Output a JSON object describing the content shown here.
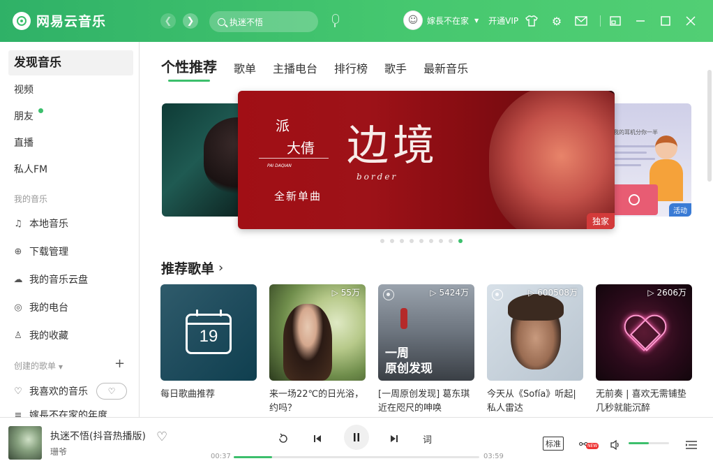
{
  "app": {
    "title": "网易云音乐"
  },
  "header": {
    "search_text": "执迷不悟",
    "username": "嫁長不在家",
    "vip_label": "开通VIP"
  },
  "sidebar": {
    "main_item": "发现音乐",
    "items": [
      "视频",
      "朋友",
      "直播",
      "私人FM"
    ],
    "my_music_label": "我的音乐",
    "my_music": [
      "本地音乐",
      "下载管理",
      "我的音乐云盘",
      "我的电台",
      "我的收藏"
    ],
    "created_label": "创建的歌单",
    "favorite_playlist": "我喜欢的音乐",
    "partial_item": "嫁長不在家的年度"
  },
  "tabs": [
    "个性推荐",
    "歌单",
    "主播电台",
    "排行榜",
    "歌手",
    "最新音乐"
  ],
  "banner": {
    "artist": "派 大倩",
    "artist_line1": "派",
    "artist_line2": "大倩",
    "artist_en": "PAI DAQIAN",
    "subtitle": "全新单曲",
    "title": "边境",
    "title_en": "border",
    "badge": "独家",
    "right_badge": "活动",
    "right_heading": "我的耳机分你一半",
    "dots_total": 9,
    "dot_active": 9
  },
  "recommend": {
    "title": "推荐歌单",
    "cards": [
      {
        "caption": "每日歌曲推荐",
        "plays": "",
        "day": "19"
      },
      {
        "caption": "来一场22℃的日光浴，约吗？",
        "plays": "55万"
      },
      {
        "caption": "[一周原创发现] 葛东琪近在咫尺的呻唤",
        "plays": "5424万",
        "overlay": "一周\n原创发现"
      },
      {
        "caption": "今天从《Sofía》听起|私人雷达",
        "plays": "600508万"
      },
      {
        "caption": "无前奏 | 喜欢无需铺垫几秒就能沉醉",
        "plays": "2606万"
      }
    ]
  },
  "player": {
    "song": "执迷不悟(抖音热播版)",
    "artist": "珊爷",
    "current_time": "00:37",
    "total_time": "03:59",
    "progress": 0.155,
    "lyrics_label": "词",
    "quality": "标准",
    "new_badge": "NEW",
    "volume": 0.5
  }
}
